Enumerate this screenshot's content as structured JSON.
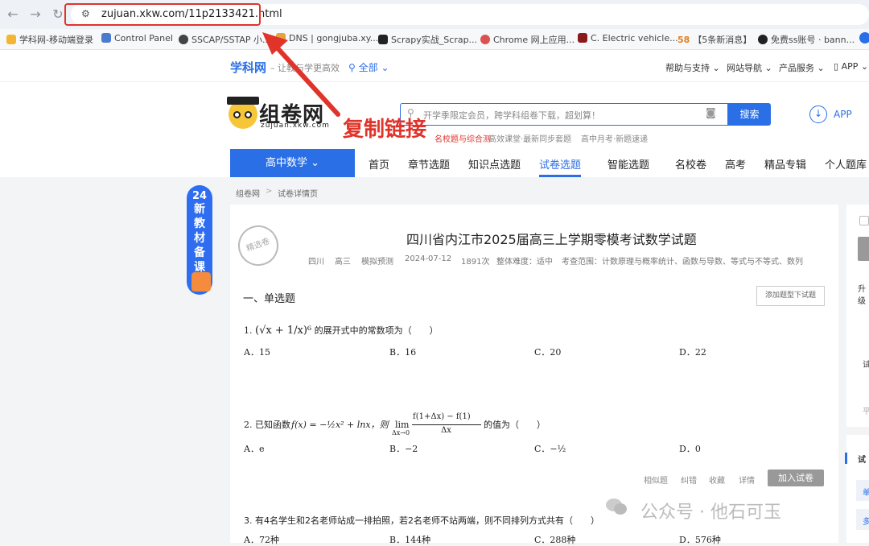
{
  "browser": {
    "url": "zujuan.xkw.com/11p2133421.html",
    "bookmarks": [
      {
        "label": "学科网-移动端登录",
        "color": "#f2b632"
      },
      {
        "label": "Control Panel",
        "color": "#4a7bd0"
      },
      {
        "label": "SSCAP/SSTAP 小...",
        "color": "#444444"
      },
      {
        "label": "DNS | gongjuba.xy...",
        "color": "#e6a23c"
      },
      {
        "label": "Scrapy实战_Scrap...",
        "color": "#222222"
      },
      {
        "label": "Chrome 网上应用...",
        "color": "#d9534f"
      },
      {
        "label": "C. Electric vehicle...",
        "color": "#8b1a1a"
      },
      {
        "label": "【5条新消息】",
        "color": "#f0ad4e"
      },
      {
        "label": "免费ss账号 · bann...",
        "color": "#222222"
      }
    ],
    "bm58": "58"
  },
  "topnav": {
    "logo": "学科网",
    "slogan": "– 让教与学更高效",
    "region": "全部",
    "links": [
      "帮助与支持",
      "网站导航",
      "产品服务",
      "APP"
    ]
  },
  "header": {
    "brand": "组卷网",
    "brand_url": "zujuan.xkw.com",
    "search_placeholder": "开学季限定会员，跨学科组卷下载，超划算！",
    "search_button": "搜索",
    "hot": [
      "名校题与综合测",
      "高效课堂·最新同步套题",
      "高中月考·新题速递"
    ],
    "app": "APP"
  },
  "annotation": "复制链接",
  "subject": "高中数学",
  "menu": [
    "首页",
    "章节选题",
    "知识点选题",
    "试卷选题",
    "智能选题",
    "名校卷",
    "高考",
    "精品专辑",
    "个人题库"
  ],
  "banner": {
    "num": "24",
    "chars": [
      "新",
      "教",
      "材",
      "备",
      "课"
    ]
  },
  "breadcrumb": [
    "组卷网",
    ">",
    "试卷详情页"
  ],
  "paper": {
    "stamp": "精选卷",
    "title": "四川省内江市2025届高三上学期零模考试数学试题",
    "meta": [
      "四川",
      "高三",
      "模拟预测",
      "2024-07-12",
      "1891次",
      "整体难度：适中",
      "考查范围：计数原理与概率统计、函数与导数、等式与不等式、数列"
    ],
    "section": "一、单选题",
    "add_button": "添加题型下试题",
    "q1": {
      "prefix": "1.",
      "expr": "(√x + 1/x)⁶",
      "suffix": "的展开式中的常数项为（　　）",
      "options": [
        "A．15",
        "B．16",
        "C．20",
        "D．22"
      ]
    },
    "q2": {
      "prefix": "2. 已知函数",
      "func": "f(x) = −½x² + lnx，则",
      "limit": "lim",
      "limit_sub": "Δx→0",
      "frac_num": "f(1+Δx) − f(1)",
      "frac_den": "Δx",
      "suffix": "的值为（　　）",
      "options": [
        "A．e",
        "B．−2",
        "C．−½",
        "D．0"
      ]
    },
    "tools": [
      "相似题",
      "纠错",
      "收藏",
      "详情"
    ],
    "join_button": "加入试卷",
    "q3": {
      "text": "3. 有4名学生和2名老师站成一排拍照，若2名老师不站两端，则不同排列方式共有（　　）",
      "options": [
        "A．72种",
        "B．144种",
        "C．288种",
        "D．576种"
      ]
    }
  },
  "watermark": "公众号 · 他石可玉",
  "right": {
    "t1": "升级",
    "t2": "试",
    "t3": "平",
    "t4": "试",
    "t5": "单",
    "t6": "多"
  },
  "colors": {
    "accent": "#2b6fe6",
    "annotation": "#e0342a"
  }
}
